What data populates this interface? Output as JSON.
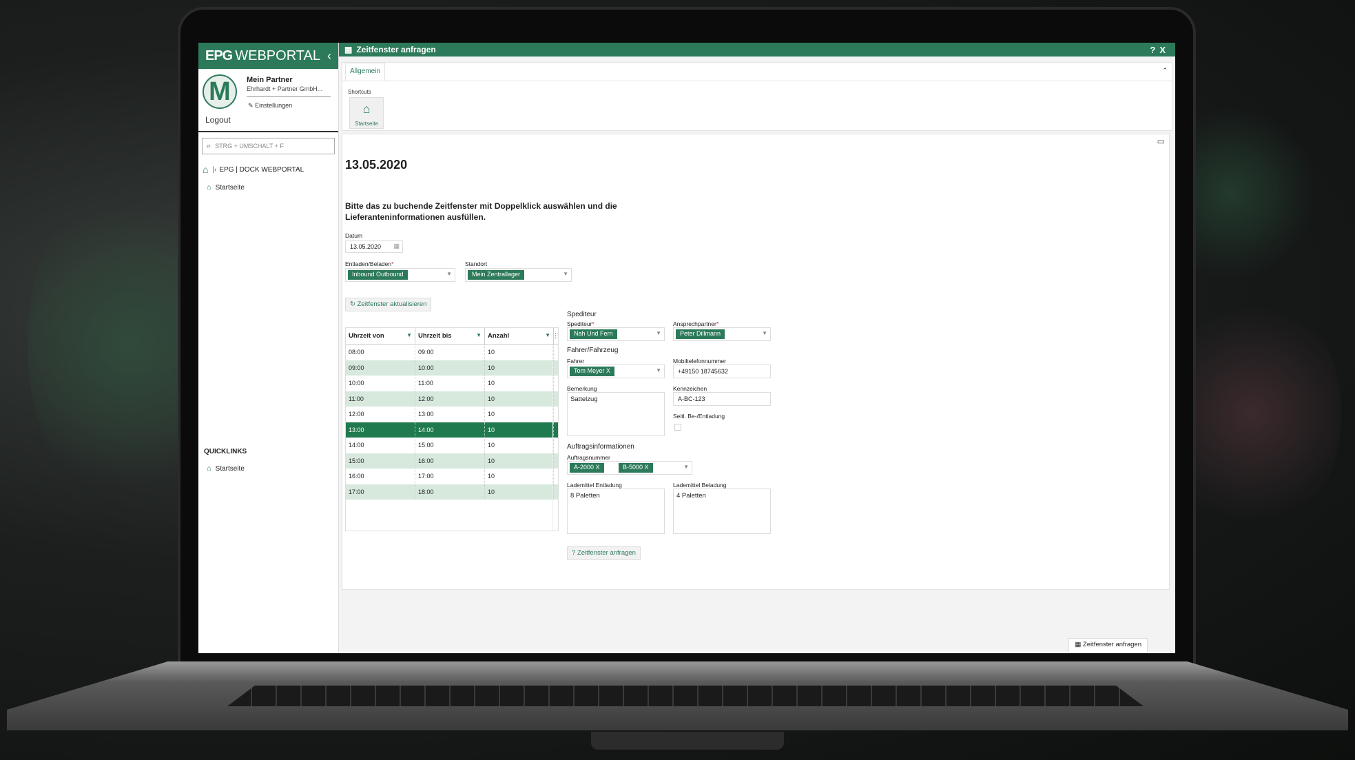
{
  "app": {
    "brand_bold": "EPG",
    "brand_light": "WEBPORTAL",
    "window_title": "Zeitfenster anfragen",
    "help": "?",
    "close": "X"
  },
  "profile": {
    "avatar_letter": "M",
    "name": "Mein Partner",
    "company": "Ehrhardt + Partner GmbH...",
    "settings": "Einstellungen",
    "logout": "Logout"
  },
  "search": {
    "placeholder": "STRG + UMSCHALT + F"
  },
  "breadcrumb": {
    "label": "EPG | DOCK WEBPORTAL"
  },
  "nav": {
    "item": "Startseite"
  },
  "quicklinks": {
    "title": "QUICKLINKS",
    "item": "Startseite"
  },
  "tabs": {
    "active": "Allgemein"
  },
  "shortcuts": {
    "label": "Shortcuts",
    "item": "Startseite"
  },
  "form": {
    "date_heading": "13.05.2020",
    "instruction": "Bitte das zu buchende Zeitfenster mit Doppelklick auswählen und die Lieferanteninformationen ausfüllen.",
    "datum_label": "Datum",
    "datum_value": "13.05.2020",
    "entladen_label": "Entladen/Beladen",
    "entladen_value": "Inbound Outbound",
    "standort_label": "Standort",
    "standort_value": "Mein Zentrallager",
    "refresh_button": "Zeitfenster aktualisieren"
  },
  "grid": {
    "headers": [
      "Uhrzeit von",
      "Uhrzeit bis",
      "Anzahl"
    ],
    "rows": [
      [
        "08:00",
        "09:00",
        "10"
      ],
      [
        "09:00",
        "10:00",
        "10"
      ],
      [
        "10:00",
        "11:00",
        "10"
      ],
      [
        "11:00",
        "12:00",
        "10"
      ],
      [
        "12:00",
        "13:00",
        "10"
      ],
      [
        "13:00",
        "14:00",
        "10"
      ],
      [
        "14:00",
        "15:00",
        "10"
      ],
      [
        "15:00",
        "16:00",
        "10"
      ],
      [
        "16:00",
        "17:00",
        "10"
      ],
      [
        "17:00",
        "18:00",
        "10"
      ]
    ],
    "selected_index": 5
  },
  "spediteur": {
    "section": "Spediteur",
    "spediteur_label": "Spediteur",
    "spediteur_value": "Nah Und Fern",
    "ansprech_label": "Ansprechpartner",
    "ansprech_value": "Peter Dillmann"
  },
  "fahrer": {
    "section": "Fahrer/Fahrzeug",
    "fahrer_label": "Fahrer",
    "fahrer_value": "Tom Meyer X",
    "mobil_label": "Mobiltelefonnummer",
    "mobil_value": "+49150 18745632",
    "bemerkung_label": "Bemerkung",
    "bemerkung_value": "Sattelzug",
    "kennzeichen_label": "Kennzeichen",
    "kennzeichen_value": "A-BC-123",
    "seitl_label": "Seitl. Be-/Entladung"
  },
  "auftrag": {
    "section": "Auftragsinformationen",
    "nummer_label": "Auftragsnummer",
    "tags": [
      "A-2000 X",
      "B-5000 X"
    ],
    "entladung_label": "Lademittel Entladung",
    "entladung_value": "8 Paletten",
    "beladung_label": "Lademittel Beladung",
    "beladung_value": "4 Paletten",
    "submit_button": "Zeitfenster anfragen"
  },
  "statusbar": {
    "item": "Zeitfenster anfragen"
  },
  "colors": {
    "accent": "#2c7a5a",
    "row_alt": "#d7e8dd",
    "row_selected": "#1f7a4f"
  }
}
